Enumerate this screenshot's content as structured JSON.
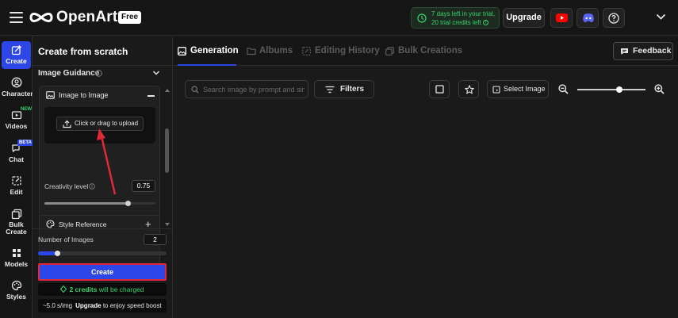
{
  "header": {
    "logo_text": "OpenArt",
    "plan_badge": "Free",
    "trial_line1": "7 days left in your trial,",
    "trial_line2": "20 trial credits left",
    "upgrade_label": "Upgrade",
    "icons": [
      "menu-icon",
      "youtube-icon",
      "discord-icon",
      "help-icon",
      "chevron-down-icon"
    ]
  },
  "sidebar": {
    "items": [
      {
        "label": "Create",
        "icon": "create-icon",
        "active": true
      },
      {
        "label": "Character",
        "icon": "character-icon"
      },
      {
        "label": "Videos",
        "icon": "video-icon",
        "badge": "NEW"
      },
      {
        "label": "Chat",
        "icon": "chat-icon",
        "badge": "BETA"
      },
      {
        "label": "Edit",
        "icon": "edit-icon"
      },
      {
        "label": "Bulk",
        "label2": "Create",
        "icon": "bulk-create-icon"
      },
      {
        "label": "Models",
        "icon": "models-icon"
      },
      {
        "label": "Styles",
        "icon": "styles-icon"
      }
    ]
  },
  "panel": {
    "title": "Create from scratch",
    "guidance_title": "Image Guidance",
    "image_to_image": {
      "label": "Image to Image",
      "upload_label": "Click or drag to upload"
    },
    "creativity": {
      "label": "Creativity level",
      "value": "0.75",
      "fraction": 0.75
    },
    "style_reference_label": "Style Reference",
    "num_images": {
      "label": "Number of Images",
      "value": "2",
      "fraction": 0.15
    },
    "create_label": "Create",
    "credits_amount": "2 credits",
    "credits_suffix": "will be charged",
    "speed_value": "~5.0 s/img",
    "speed_link": "Upgrade",
    "speed_suffix": "to enjoy speed boost"
  },
  "tabs": [
    {
      "label": "Generation",
      "icon": "image-icon",
      "active": true
    },
    {
      "label": "Albums",
      "icon": "folder-icon"
    },
    {
      "label": "Editing History",
      "icon": "edit-history-icon"
    },
    {
      "label": "Bulk Creations",
      "icon": "bulk-icon"
    }
  ],
  "feedback_label": "Feedback",
  "toolbar": {
    "search_placeholder": "Search image by prompt and similar",
    "filters_label": "Filters",
    "select_image_label": "Select Image",
    "zoom_fraction": 0.62
  },
  "colors": {
    "accent": "#2d46e8",
    "trial_green": "#39d36b",
    "highlight_red": "#e0283a",
    "youtube_red": "#ff0000",
    "discord_blue": "#5865f2"
  }
}
